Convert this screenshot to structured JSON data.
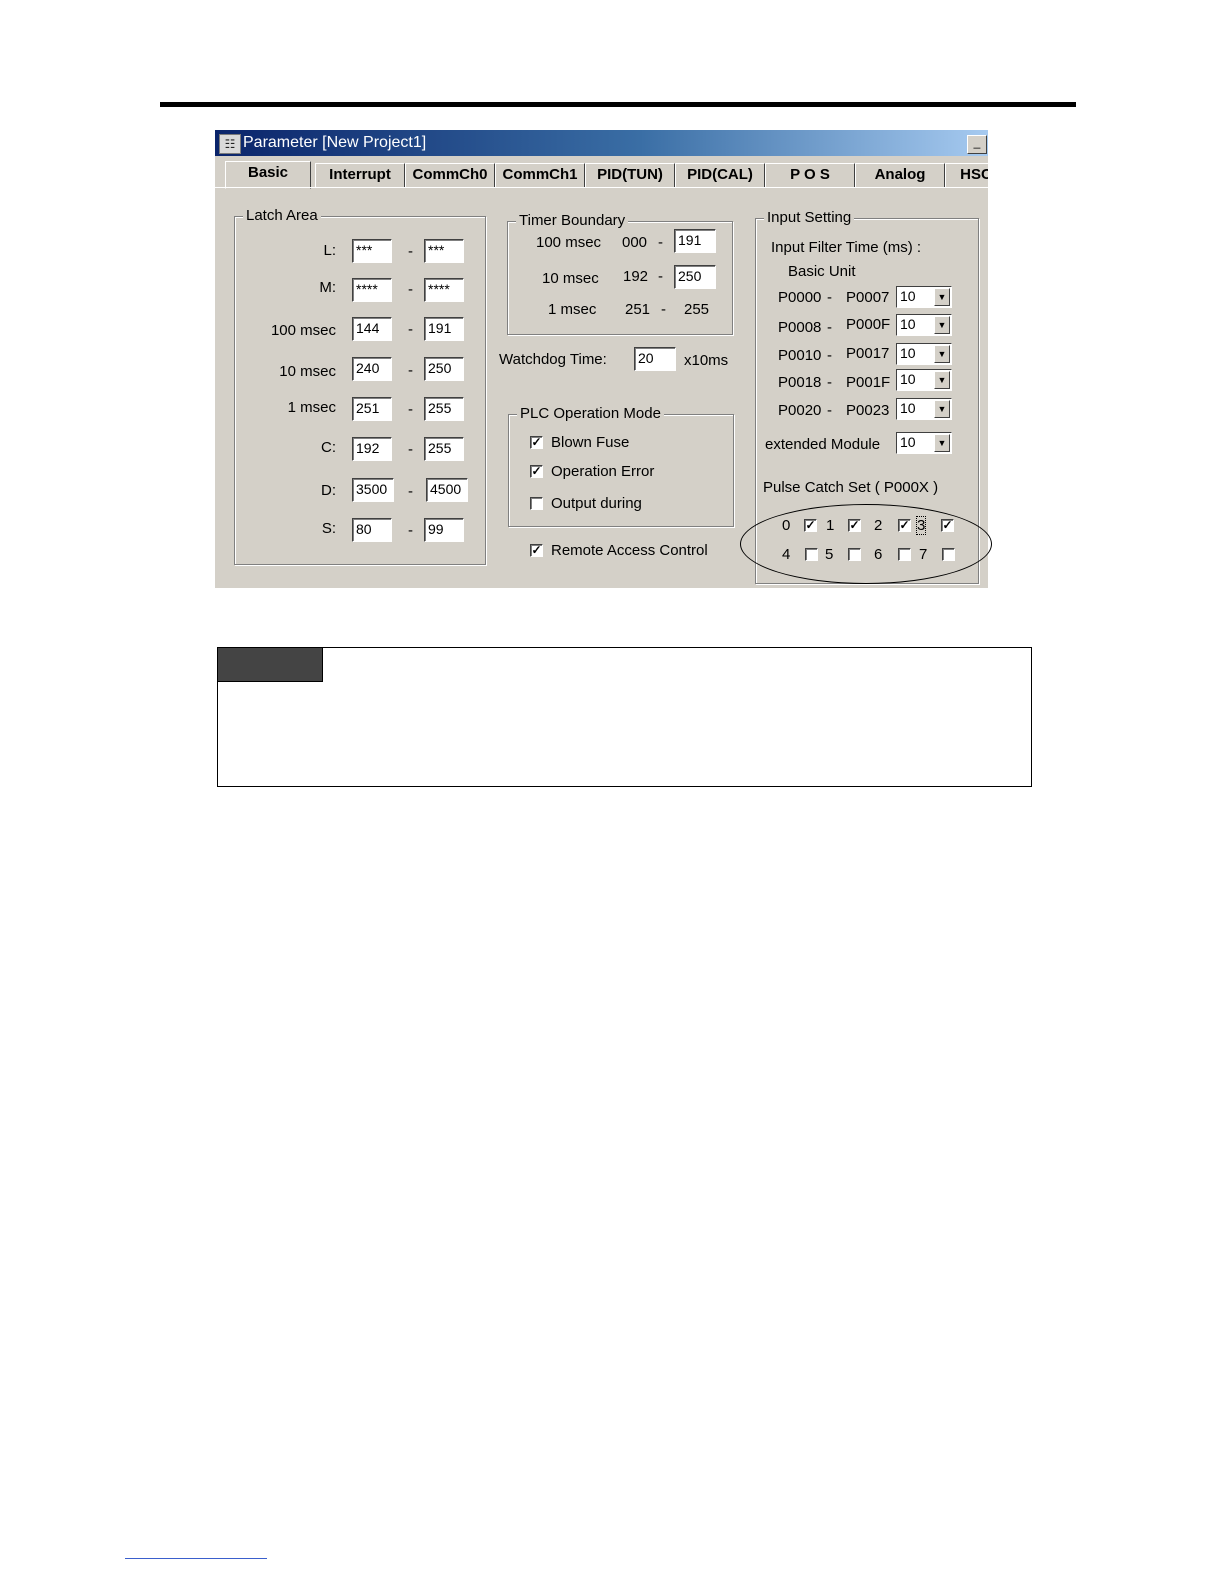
{
  "window": {
    "title": "Parameter [New Project1]",
    "icon": "app-icon",
    "minimize": "_"
  },
  "tabs": [
    "Basic",
    "Interrupt",
    "CommCh0",
    "CommCh1",
    "PID(TUN)",
    "PID(CAL)",
    "P O S",
    "Analog",
    "HSC"
  ],
  "latch": {
    "title": "Latch Area",
    "rows": [
      {
        "label": "L:",
        "from": "***",
        "to": "***"
      },
      {
        "label": "M:",
        "from": "****",
        "to": "****"
      },
      {
        "label": "100 msec",
        "from": "144",
        "to": "191"
      },
      {
        "label": "10 msec",
        "from": "240",
        "to": "250"
      },
      {
        "label": "1 msec",
        "from": "251",
        "to": "255"
      },
      {
        "label": "C:",
        "from": "192",
        "to": "255"
      },
      {
        "label": "D:",
        "from": "3500",
        "to": "4500"
      },
      {
        "label": "S:",
        "from": "80",
        "to": "99"
      }
    ],
    "dash": "-"
  },
  "timer": {
    "title": "Timer Boundary",
    "rows": [
      {
        "label": "100 msec",
        "from": "000",
        "to": "191"
      },
      {
        "label": "10 msec",
        "from": "192",
        "to": "250"
      },
      {
        "label": "1 msec",
        "from": "251",
        "to": "255"
      }
    ]
  },
  "watchdog": {
    "label": "Watchdog Time:",
    "value": "20",
    "unit": "x10ms"
  },
  "plc_mode": {
    "title": "PLC Operation Mode",
    "items": [
      {
        "label": "Blown Fuse",
        "checked": true,
        "mark": "✓"
      },
      {
        "label": "Operation Error",
        "checked": true,
        "mark": "✓"
      },
      {
        "label": "Output during",
        "checked": false,
        "mark": ""
      }
    ]
  },
  "remote": {
    "label": "Remote Access Control",
    "checked": true,
    "mark": "✓"
  },
  "input": {
    "title": "Input Setting",
    "filter_label": "Input Filter Time (ms) :",
    "unit_label": "Basic Unit",
    "rows": [
      {
        "from": "P0000",
        "to": "P0007",
        "value": "10"
      },
      {
        "from": "P0008",
        "to": "P000F",
        "value": "10"
      },
      {
        "from": "P0010",
        "to": "P0017",
        "value": "10"
      },
      {
        "from": "P0018",
        "to": "P001F",
        "value": "10"
      },
      {
        "from": "P0020",
        "to": "P0023",
        "value": "10"
      }
    ],
    "ext_label": "extended Module",
    "ext_value": "10",
    "arrow": "▼"
  },
  "pulse": {
    "title": "Pulse Catch Set ( P000X )",
    "items": [
      {
        "label": "0",
        "checked": true,
        "mark": "✓"
      },
      {
        "label": "1",
        "checked": true,
        "mark": "✓"
      },
      {
        "label": "2",
        "checked": true,
        "mark": "✓"
      },
      {
        "label": "3",
        "checked": true,
        "mark": "✓"
      },
      {
        "label": "4",
        "checked": false,
        "mark": ""
      },
      {
        "label": "5",
        "checked": false,
        "mark": ""
      },
      {
        "label": "6",
        "checked": false,
        "mark": ""
      },
      {
        "label": "7",
        "checked": false,
        "mark": ""
      }
    ]
  },
  "colors": {
    "title_start": "#0a246a",
    "title_end": "#a6caf0",
    "face": "#d4d0c8",
    "note_tag": "#444444"
  }
}
